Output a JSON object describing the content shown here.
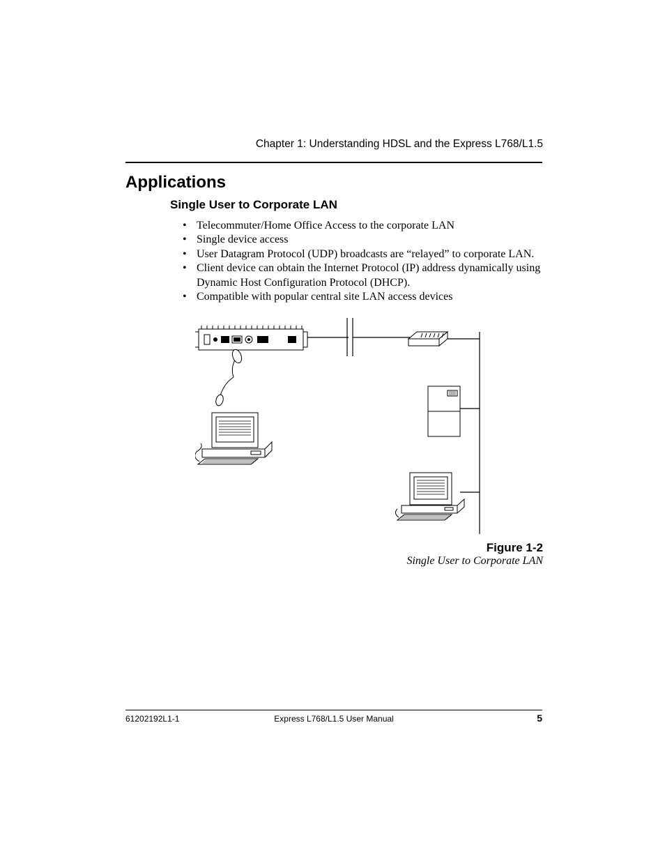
{
  "runningHead": "Chapter 1: Understanding HDSL and the Express L768/L1.5",
  "heading1": "Applications",
  "heading2": "Single User to Corporate LAN",
  "bullets": [
    "Telecommuter/Home Office Access to the corporate LAN",
    "Single device access",
    "User Datagram Protocol (UDP) broadcasts are “relayed” to corporate LAN.",
    "Client device can obtain the Internet Protocol (IP) address dynamically using Dynamic Host Configuration Protocol (DHCP).",
    "Compatible with popular central site LAN access devices"
  ],
  "figure": {
    "number": "Figure 1-2",
    "title": "Single User to Corporate LAN"
  },
  "footer": {
    "left": "61202192L1-1",
    "center": "Express L768/L1.5 User Manual",
    "pageNumber": "5"
  }
}
